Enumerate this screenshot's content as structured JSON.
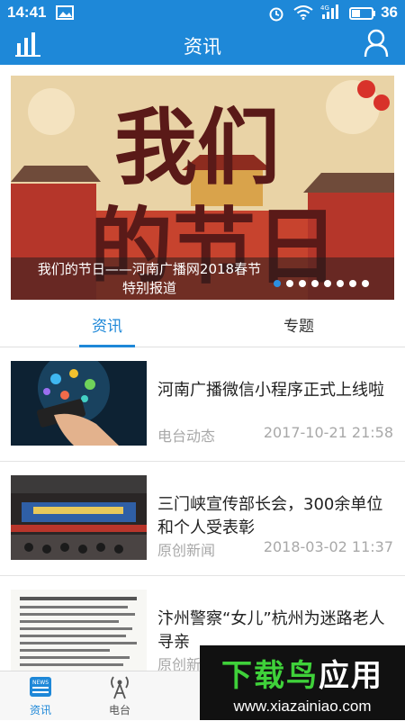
{
  "status_bar": {
    "time": "14:41",
    "network": "4G",
    "battery": "36"
  },
  "header": {
    "title": "资讯",
    "left_icon": "bar-chart-icon",
    "right_icon": "user-icon"
  },
  "banner": {
    "art_text": [
      "我们",
      "的节日"
    ],
    "caption_line1": "我们的节日——河南广播网2018春节",
    "caption_line2": "特别报道",
    "slide_count": 8,
    "active_slide": 1
  },
  "tabs": [
    {
      "label": "资讯",
      "active": true
    },
    {
      "label": "专题",
      "active": false
    }
  ],
  "news": [
    {
      "title": "河南广播微信小程序正式上线啦",
      "source": "电台动态",
      "time": "2017-10-21 21:58"
    },
    {
      "title": "三门峡宣传部长会，300余单位和个人受表彰",
      "source": "原创新闻",
      "time": "2018-03-02 11:37"
    },
    {
      "title": "汴州警察“女儿”杭州为迷路老人寻亲",
      "source": "原创新",
      "time": ""
    }
  ],
  "bottom_nav": [
    {
      "label": "资讯",
      "icon": "news-icon",
      "active": true
    },
    {
      "label": "电台",
      "icon": "radio-tower-icon",
      "active": false
    }
  ],
  "watermark": {
    "title": "下载鸟应用",
    "url": "www.xiazainiao.com"
  },
  "colors": {
    "primary": "#1e88d8",
    "banner_red": "#c9412d",
    "text_dark": "#222222",
    "text_muted": "#a8a8a8"
  }
}
